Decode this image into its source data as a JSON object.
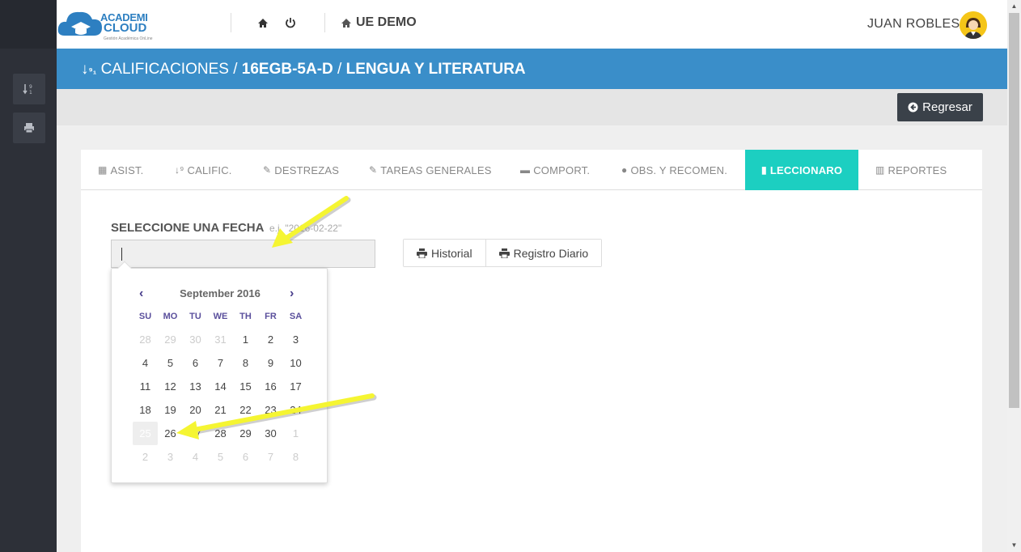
{
  "brand": {
    "line1": "ACADEMI",
    "line2": "CLOUD",
    "tagline": "Gestión Académica OnLine"
  },
  "header": {
    "school": "UE DEMO",
    "user": "JUAN ROBLES"
  },
  "titlebar": {
    "section": "CALIFICACIONES",
    "separator": "/",
    "course": "16EGB-5A-D",
    "subject": "LENGUA Y LITERATURA"
  },
  "toolbar": {
    "back_label": "Regresar"
  },
  "tabs": [
    {
      "label": "ASIST.",
      "icon": "calendar-icon",
      "active": false
    },
    {
      "label": "CALIFIC.",
      "icon": "sort-numeric-icon",
      "active": false
    },
    {
      "label": "DESTREZAS",
      "icon": "edit-icon",
      "active": false
    },
    {
      "label": "TAREAS GENERALES",
      "icon": "edit-icon",
      "active": false
    },
    {
      "label": "COMPORT.",
      "icon": "comment-box-icon",
      "active": false
    },
    {
      "label": "OBS. Y RECOMEN.",
      "icon": "comments-icon",
      "active": false
    },
    {
      "label": "LECCIONARO",
      "icon": "book-icon",
      "active": true
    },
    {
      "label": "REPORTES",
      "icon": "bar-chart-icon",
      "active": false
    }
  ],
  "date_field": {
    "label": "SELECCIONE UNA FECHA",
    "hint": "e.j. \"2016-02-22\"",
    "value": ""
  },
  "buttons": {
    "historial": "Historial",
    "registro": "Registro Diario"
  },
  "datepicker": {
    "month_label": "September 2016",
    "prev": "‹",
    "next": "›",
    "weekdays": [
      "SU",
      "MO",
      "TU",
      "WE",
      "TH",
      "FR",
      "SA"
    ],
    "weeks": [
      [
        "28",
        "29",
        "30",
        "31",
        "1",
        "2",
        "3"
      ],
      [
        "4",
        "5",
        "6",
        "7",
        "8",
        "9",
        "10"
      ],
      [
        "11",
        "12",
        "13",
        "14",
        "15",
        "16",
        "17"
      ],
      [
        "18",
        "19",
        "20",
        "21",
        "22",
        "23",
        "24"
      ],
      [
        "25",
        "26",
        "27",
        "28",
        "29",
        "30",
        "1"
      ],
      [
        "2",
        "3",
        "4",
        "5",
        "6",
        "7",
        "8"
      ]
    ],
    "today": "25"
  },
  "colors": {
    "sidebar": "#2d3038",
    "titlebar": "#3a8ec9",
    "active_tab": "#1ccfc1",
    "annotation_arrow": "#f5f532"
  }
}
